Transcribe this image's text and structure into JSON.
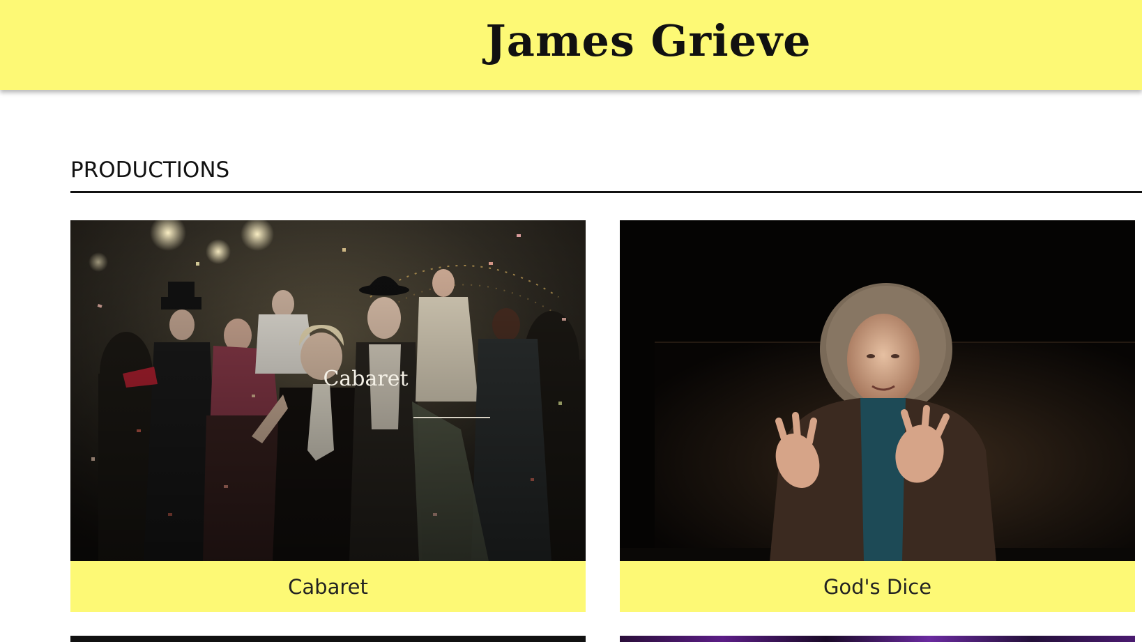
{
  "header": {
    "site_title": "James Grieve",
    "background_color": "#fdf975"
  },
  "main": {
    "section_heading": "PRODUCTIONS",
    "productions": [
      {
        "caption": "Cabaret",
        "image_overlay_title": "Cabaret",
        "image_description": "ensemble-cast-with-confetti"
      },
      {
        "caption": "God's Dice",
        "image_description": "actor-gesturing-on-dark-stage"
      }
    ]
  },
  "colors": {
    "accent_yellow": "#fdf975",
    "text_dark": "#111111"
  }
}
